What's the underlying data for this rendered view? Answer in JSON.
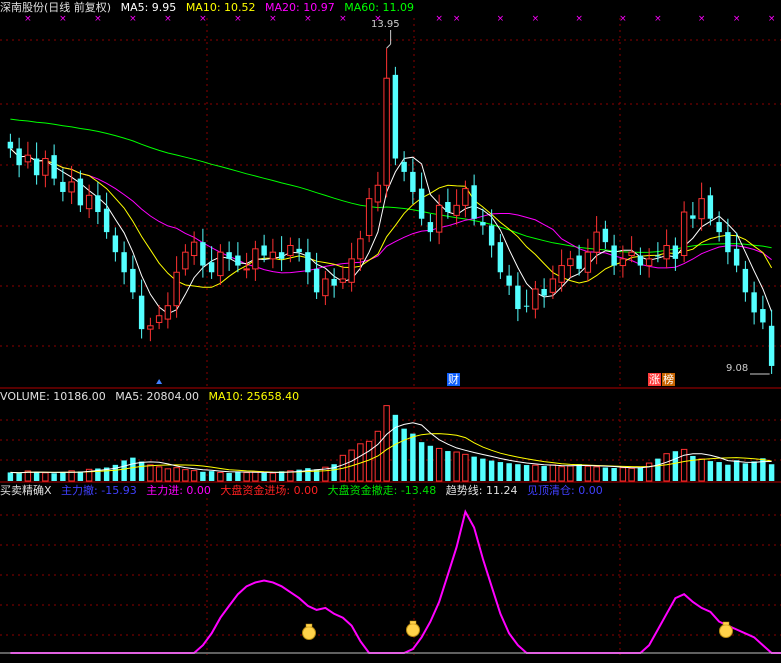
{
  "price_header": {
    "title": "深南股份(日线 前复权)",
    "ma5": "MA5: 9.95",
    "ma10": "MA10: 10.52",
    "ma20": "MA20: 10.97",
    "ma60": "MA60: 11.09"
  },
  "volume_header": {
    "label": "VOLUME: 10186.00",
    "ma5": "MA5: 20804.00",
    "ma10": "MA10: 25658.40"
  },
  "indicator_header": {
    "name": "买卖精确X",
    "main_out": "主力撤: -15.93",
    "main_in": "主力进: 0.00",
    "big_in": "大盘资金进场: 0.00",
    "big_out": "大盘资金撤走: -13.48",
    "trend": "趋势线: 11.24",
    "take_profit": "见顶清仓: 0.00"
  },
  "markers": {
    "high_label": "13.95",
    "low_label": "9.08",
    "cai": "财",
    "zhang": "涨",
    "bang": "榜"
  },
  "colors": {
    "up": "#ff3232",
    "down": "#54ffff",
    "ma5": "#ffffff",
    "ma10": "#ffff00",
    "ma20": "#ff00ff",
    "ma60": "#00ff00",
    "indicator": "#ff00ff",
    "grid": "#8b0000"
  },
  "chart_data": [
    {
      "type": "candlestick",
      "title": "深南股份(日线 前复权)",
      "ylim": [
        8.9,
        14.4
      ],
      "highest": 13.95,
      "lowest": 9.08,
      "closes": [
        12.45,
        12.2,
        12.35,
        12.05,
        12.3,
        12.0,
        11.8,
        11.95,
        11.6,
        11.75,
        11.5,
        11.2,
        10.9,
        10.6,
        10.3,
        9.75,
        9.8,
        9.95,
        10.1,
        10.6,
        10.9,
        11.05,
        10.7,
        10.6,
        10.9,
        10.8,
        10.7,
        10.65,
        10.95,
        10.85,
        10.9,
        10.8,
        11.0,
        10.9,
        10.6,
        10.3,
        10.5,
        10.4,
        10.5,
        10.8,
        11.1,
        11.7,
        11.9,
        13.5,
        12.3,
        12.1,
        11.8,
        11.4,
        11.2,
        11.6,
        11.5,
        11.6,
        11.85,
        11.4,
        11.3,
        11.0,
        10.6,
        10.4,
        10.05,
        10.1,
        10.35,
        10.25,
        10.5,
        10.7,
        10.8,
        10.65,
        10.9,
        11.2,
        11.05,
        10.7,
        10.8,
        10.9,
        10.7,
        10.8,
        10.85,
        11.0,
        10.8,
        11.5,
        11.4,
        11.7,
        11.4,
        11.2,
        10.9,
        10.7,
        10.3,
        10.0,
        9.85,
        9.2
      ]
    },
    {
      "type": "bar",
      "title": "VOLUME",
      "values": [
        5200,
        4800,
        6100,
        5500,
        5000,
        4700,
        5300,
        6200,
        5800,
        7100,
        7600,
        8200,
        9800,
        12500,
        14200,
        11800,
        9800,
        8600,
        7400,
        8100,
        6900,
        6300,
        5600,
        6000,
        5200,
        4900,
        5800,
        5100,
        5400,
        5000,
        4800,
        5900,
        6200,
        6900,
        7800,
        7100,
        8400,
        10200,
        15600,
        18800,
        22600,
        24100,
        30200,
        45800,
        40200,
        31800,
        28800,
        23600,
        21400,
        19800,
        18200,
        17600,
        16200,
        14800,
        13600,
        12400,
        11500,
        10800,
        10200,
        9700,
        9600,
        9100,
        9800,
        8700,
        9200,
        10300,
        9000,
        8600,
        8200,
        7900,
        8100,
        7700,
        8300,
        10900,
        13600,
        16600,
        18100,
        19200,
        15200,
        13400,
        12100,
        11500,
        9900,
        12600,
        10700,
        11900,
        13800,
        10186
      ],
      "ma5": 20804.0,
      "ma10": 25658.4
    },
    {
      "type": "line",
      "title": "买卖精确X",
      "series": [
        {
          "name": "主力撤",
          "values": [
            0,
            0,
            0,
            0,
            0,
            0,
            0,
            0,
            0,
            0,
            0,
            0,
            0,
            0,
            0,
            0,
            0,
            0,
            0,
            0,
            0,
            0,
            -2,
            -5,
            -9,
            -12,
            -15,
            -17,
            -18,
            -18.5,
            -18,
            -17,
            -15.5,
            -14,
            -12,
            -11,
            -11.5,
            -10,
            -9,
            -7,
            -3,
            0,
            0,
            0,
            0,
            0,
            -1,
            -4,
            -8,
            -13,
            -20,
            -27,
            -36,
            -32,
            -24,
            -17,
            -10,
            -5,
            -2,
            0,
            0,
            0,
            0,
            0,
            0,
            0,
            0,
            0,
            0,
            0,
            0,
            0,
            0,
            -2,
            -6,
            -10,
            -14,
            -15,
            -13,
            -11.5,
            -10.5,
            -8,
            -7,
            -6,
            -5,
            -4,
            -2,
            0,
            0,
            0,
            0,
            0,
            0,
            0,
            0
          ]
        }
      ]
    }
  ]
}
